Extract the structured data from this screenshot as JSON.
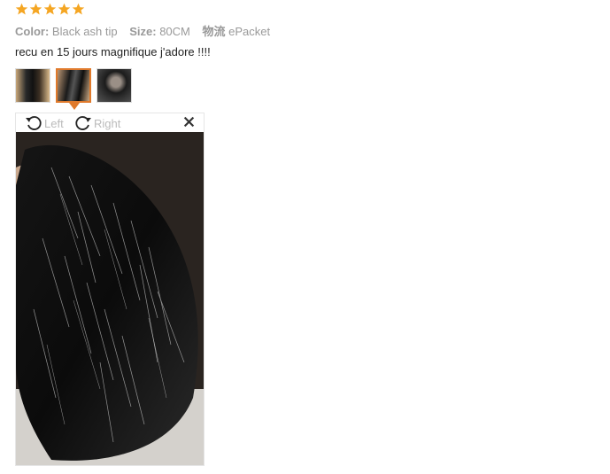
{
  "review": {
    "rating": 5,
    "star_color": "#f5a623",
    "attributes": [
      {
        "key": "Color:",
        "value": "Black ash tip"
      },
      {
        "key": "Size:",
        "value": "80CM"
      },
      {
        "key": "物流",
        "value": "ePacket"
      }
    ],
    "text": "recu en 15 jours magnifique j'adore !!!!",
    "thumbnails": [
      {
        "name": "photo-thumb-1",
        "active": false
      },
      {
        "name": "photo-thumb-2",
        "active": true
      },
      {
        "name": "photo-thumb-3",
        "active": false
      }
    ],
    "accent_color": "#e07a2c"
  },
  "viewer": {
    "rotate_left_label": "Left",
    "rotate_right_label": "Right",
    "close_icon": "close-icon",
    "image_subject": "black fur collar with ash tips held in hand"
  }
}
